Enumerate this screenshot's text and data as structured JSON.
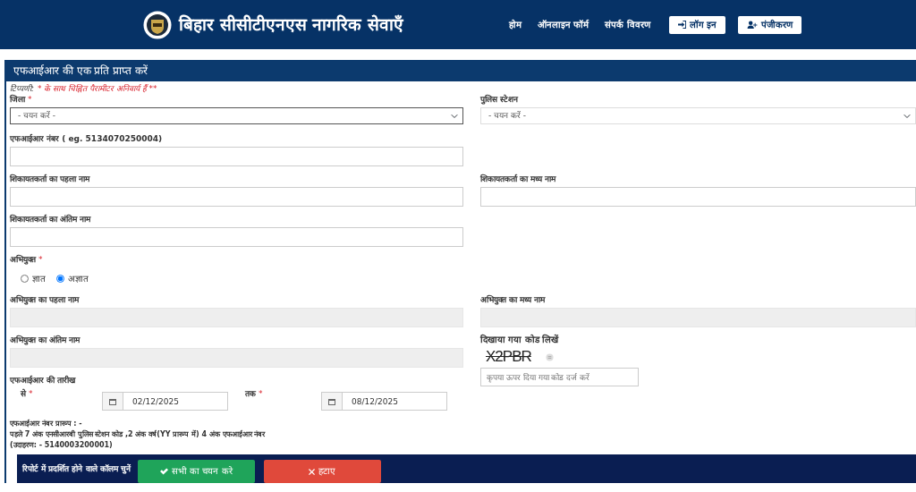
{
  "header": {
    "title": "बिहार सीसीटीएनएस नागरिक सेवाएँ",
    "nav": [
      "होम",
      "ऑनलाइन फॉर्म",
      "संपर्क विवरण"
    ],
    "buttons": [
      {
        "label": "लॉग इन",
        "kind": "login"
      },
      {
        "label": "पंजीकरण",
        "kind": "register"
      }
    ]
  },
  "panel": {
    "title": "एफआईआर की एक प्रति प्राप्त करें",
    "note_prefix": "टिप्पणी:",
    "note": "* के साथ चिह्नित पैरामीटर अनिवार्य हैं **",
    "rows": [
      {
        "left": [
          {
            "kind": "select",
            "label": "जिला",
            "mark": "*",
            "value": "- चयन करें -",
            "focused": true
          }
        ],
        "right": [
          {
            "kind": "select",
            "label": "पुलिस स्टेशन",
            "value": "- चयन करें -",
            "focused": false
          }
        ]
      },
      {
        "left": [
          {
            "kind": "text",
            "label": "एफआईआर नंबर ( eg. 5134070250004)",
            "disabled": false
          }
        ],
        "right": []
      },
      {
        "left": [
          {
            "kind": "text",
            "label": "शिकायतकर्ता का पहला नाम",
            "disabled": false
          }
        ],
        "right": [
          {
            "kind": "text",
            "label": "शिकायतकर्ता का मध्य नाम",
            "disabled": false
          }
        ]
      },
      {
        "left": [
          {
            "kind": "text",
            "label": "शिकायतकर्ता का अंतिम नाम",
            "disabled": false
          }
        ],
        "right": []
      },
      {
        "left": [
          {
            "kind": "radio",
            "label": "अभियुक्त",
            "mark": "*",
            "options": [
              {
                "label": "ज्ञात",
                "selected": false
              },
              {
                "label": "अज्ञात",
                "selected": true
              }
            ]
          }
        ],
        "right": []
      },
      {
        "left": [
          {
            "kind": "text",
            "label": "अभियुक्त का पहला नाम",
            "disabled": true
          }
        ],
        "right": [
          {
            "kind": "text",
            "label": "अभियुक्त का मध्य नाम",
            "disabled": true
          }
        ]
      },
      {
        "left": [
          {
            "kind": "text",
            "label": "अभियुक्त का अंतिम नाम",
            "disabled": true
          },
          {
            "kind": "date_range",
            "label": "एफआईआर की तारीख",
            "from_label": "से",
            "from_mark": "*",
            "from_value": "02/12/2025",
            "to_label": "तक",
            "to_mark": "*",
            "to_value": "08/12/2025"
          },
          {
            "kind": "note",
            "lines": [
              "एफआईआर नंबर प्रारूप : -",
              "पहले 7 अंक एनसीआरबी पुलिस स्टेशन कोड ,2 अंक वर्ष(YY प्रारूप में) 4 अंक एफआईआर नंबर",
              "(उदाहरण: - 5140003200001)"
            ]
          }
        ],
        "right": [
          {
            "kind": "captcha",
            "label": "दिखाया गया कोड लिखें",
            "code": "X2PBR",
            "placeholder": "कृपया ऊपर दिया गया कोड दर्ज करें"
          }
        ]
      }
    ]
  },
  "column_bar": {
    "label": "रिपोर्ट में प्रदर्शित होने वाले कॉलम चुनें",
    "buttons": [
      {
        "label": "सभी का चयन करे",
        "kind": "select_all"
      },
      {
        "label": "हटाए",
        "kind": "remove"
      }
    ]
  }
}
